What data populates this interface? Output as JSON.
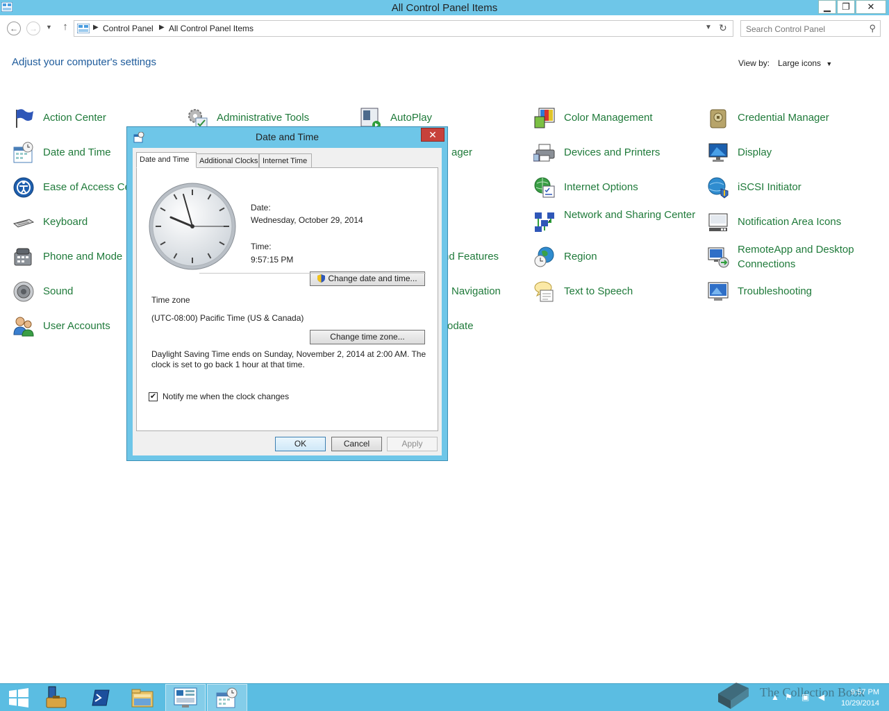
{
  "window": {
    "title": "All Control Panel Items",
    "minimize": "▁",
    "maximize": "❐",
    "close": "✕"
  },
  "address": {
    "crumbs": [
      "Control Panel",
      "All Control Panel Items"
    ],
    "search_placeholder": "Search Control Panel"
  },
  "page": {
    "heading": "Adjust your computer's settings",
    "view_by_label": "View by:",
    "view_by_value": "Large icons"
  },
  "items": [
    {
      "label": "Action Center",
      "icon": "flag-icon"
    },
    {
      "label": "Administrative Tools",
      "icon": "admin-tools-icon"
    },
    {
      "label": "AutoPlay",
      "icon": "autoplay-icon"
    },
    {
      "label": "Color Management",
      "icon": "color-management-icon"
    },
    {
      "label": "Credential Manager",
      "icon": "credential-manager-icon"
    },
    {
      "label": "Date and Time",
      "icon": "calendar-clock-icon"
    },
    {
      "label": "ager",
      "icon": ""
    },
    {
      "label": "Devices and Printers",
      "icon": "printer-icon"
    },
    {
      "label": "Display",
      "icon": "monitor-icon"
    },
    {
      "label": "Ease of Access Ce",
      "icon": "ease-of-access-icon"
    },
    {
      "label": "Internet Options",
      "icon": "internet-options-icon"
    },
    {
      "label": "iSCSI Initiator",
      "icon": "iscsi-icon"
    },
    {
      "label": "Keyboard",
      "icon": "keyboard-icon"
    },
    {
      "label": "Network and Sharing Center",
      "icon": "network-icon"
    },
    {
      "label": "Notification Area Icons",
      "icon": "notification-icon"
    },
    {
      "label": "Phone and Mode",
      "icon": "phone-modem-icon"
    },
    {
      "label": "nd Features",
      "icon": ""
    },
    {
      "label": "Region",
      "icon": "region-icon"
    },
    {
      "label": "RemoteApp and Desktop Connections",
      "icon": "remoteapp-icon"
    },
    {
      "label": "Sound",
      "icon": "speaker-icon"
    },
    {
      "label": "Navigation",
      "icon": ""
    },
    {
      "label": "Text to Speech",
      "icon": "speech-bubble-icon"
    },
    {
      "label": "Troubleshooting",
      "icon": "troubleshooting-icon"
    },
    {
      "label": "User Accounts",
      "icon": "users-icon"
    },
    {
      "label": "odate",
      "icon": ""
    }
  ],
  "dialog": {
    "title": "Date and Time",
    "close": "✕",
    "tabs": [
      "Date and Time",
      "Additional Clocks",
      "Internet Time"
    ],
    "date_label": "Date:",
    "date_value": "Wednesday, October 29, 2014",
    "time_label": "Time:",
    "time_value": "9:57:15 PM",
    "change_datetime_button": "Change date and time...",
    "time_zone_heading": "Time zone",
    "time_zone_value": "(UTC-08:00) Pacific Time (US & Canada)",
    "change_timezone_button": "Change time zone...",
    "dst_text": "Daylight Saving Time ends on Sunday, November 2, 2014 at 2:00 AM. The clock is set to go back 1 hour at that time.",
    "notify_label": "Notify me when the clock changes",
    "notify_checked": true,
    "ok": "OK",
    "cancel": "Cancel",
    "apply": "Apply"
  },
  "taskbar": {
    "time": "9:57 PM",
    "date": "10/29/2014",
    "watermark": "The Collection Book"
  },
  "colors": {
    "titlebar": "#6ec6e8",
    "link_green": "#1f7a3a",
    "heading_blue": "#1e5b9b",
    "taskbar": "#5bbde2"
  }
}
